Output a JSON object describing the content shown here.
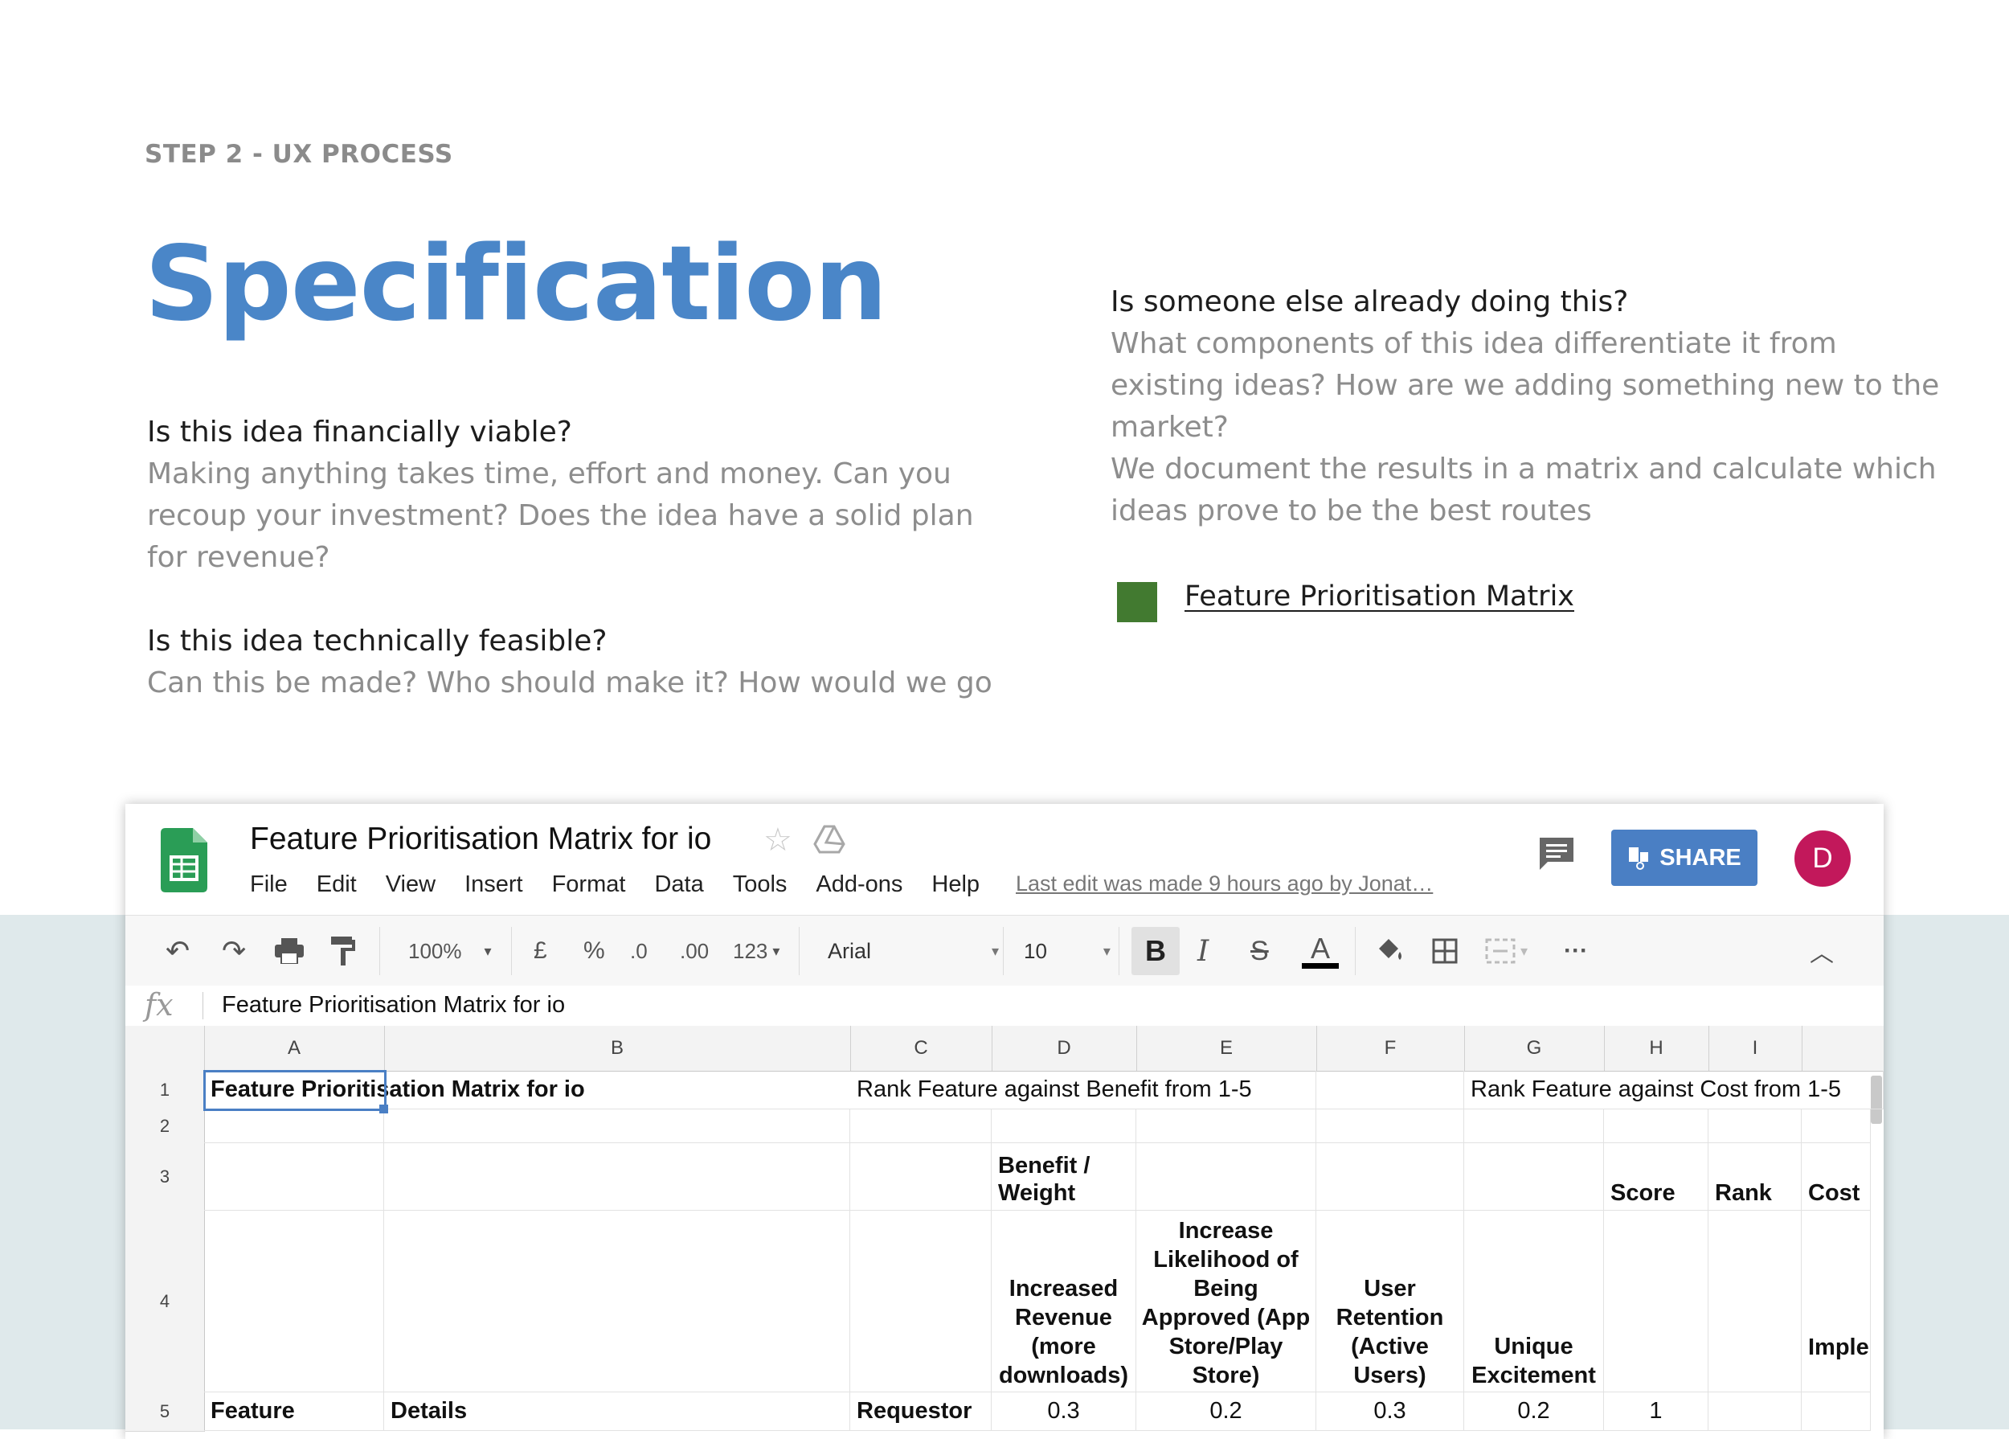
{
  "slide": {
    "eyebrow": "STEP 2 - UX PROCESS",
    "title": "Specification",
    "left_sections": [
      {
        "question": "Is this idea financially viable?",
        "answer": "Making anything takes time, effort and money. Can you recoup your investment? Does the idea have a solid plan for revenue?"
      },
      {
        "question": "Is this idea technically feasible?",
        "answer": "Can this be made? Who should make it? How would we go"
      }
    ],
    "right_section": {
      "question": "Is someone else already doing this?",
      "answer": "What components of this idea differentiate it from existing ideas? How are we adding something new to the market?",
      "note": "We document the results in a matrix and calculate which ideas prove to be the best routes"
    },
    "link_label": "Feature Prioritisation Matrix",
    "colors": {
      "title": "#4a86c8",
      "link_square": "#427a30",
      "band": "#dfe9eb"
    }
  },
  "sheet": {
    "doc_title": "Feature Prioritisation Matrix for io",
    "menu": [
      "File",
      "Edit",
      "View",
      "Insert",
      "Format",
      "Data",
      "Tools",
      "Add-ons",
      "Help"
    ],
    "last_edit": "Last edit was made 9 hours ago by Jonat…",
    "share_label": "SHARE",
    "avatar_letter": "D",
    "toolbar": {
      "zoom": "100%",
      "currency": "£",
      "percent": "%",
      "dec_less": ".0",
      "dec_more": ".00",
      "format_more": "123",
      "font": "Arial",
      "font_size": "10",
      "bold": "B",
      "italic": "I",
      "strike": "S",
      "text_color": "A",
      "more": "···"
    },
    "formula_fx": "fx",
    "formula_value": "Feature Prioritisation Matrix for io",
    "columns": [
      "A",
      "B",
      "C",
      "D",
      "E",
      "F",
      "G",
      "H",
      "I"
    ],
    "rows": [
      "1",
      "2",
      "3",
      "4",
      "5"
    ],
    "cells": {
      "a1": "Feature Prioritisation Matrix for io",
      "c1": "Rank Feature against Benefit from 1-5",
      "g1": "Rank Feature against Cost from 1-5",
      "d3": "Benefit / Weight",
      "h3": "Score",
      "i3": "Rank",
      "j3": "Cost",
      "d4": "Increased Revenue (more downloads)",
      "e4": "Increase Likelihood of Being Approved (App Store/Play Store)",
      "f4": "User Retention (Active Users)",
      "g4": "Unique Excitement",
      "j4": "Imple",
      "a5": "Feature",
      "b5": "Details",
      "c5": "Requestor",
      "d5": "0.3",
      "e5": "0.2",
      "f5": "0.3",
      "g5": "0.2",
      "h5": "1"
    }
  }
}
